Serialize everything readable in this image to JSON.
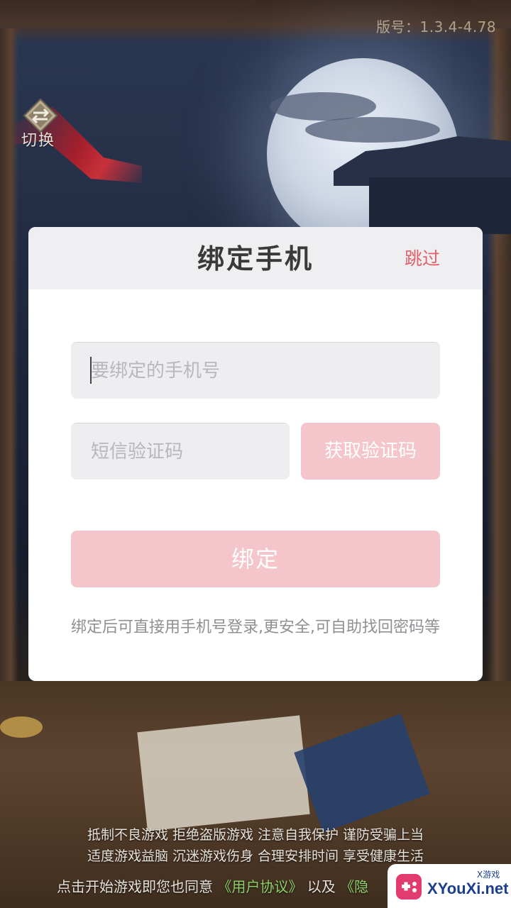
{
  "version": "版号：1.3.4-4.78",
  "switch": {
    "label": "切换",
    "icon": "swap-arrows-icon"
  },
  "dialog": {
    "title": "绑定手机",
    "skip_label": "跳过",
    "phone_placeholder": "要绑定的手机号",
    "phone_value": "",
    "code_placeholder": "短信验证码",
    "code_value": "",
    "get_code_label": "获取验证码",
    "bind_label": "绑定",
    "hint": "绑定后可直接用手机号登录,更安全,可自助找回密码等"
  },
  "notices": {
    "line1": "抵制不良游戏 拒绝盗版游戏 注意自我保护 谨防受骗上当",
    "line2": "适度游戏益脑 沉迷游戏伤身 合理安排时间 享受健康生活",
    "agree_prefix": "点击开始游戏即您也同意 ",
    "agree_link_user": "《用户协议》",
    "agree_mid": " 以及 ",
    "agree_link_privacy": "《隐"
  },
  "watermark": {
    "text": "XYouXi.net",
    "sub": "X游戏"
  },
  "colors": {
    "accent_pink": "#f4c5cb",
    "skip_red": "#e2606c",
    "link_green": "#8fd06a"
  }
}
